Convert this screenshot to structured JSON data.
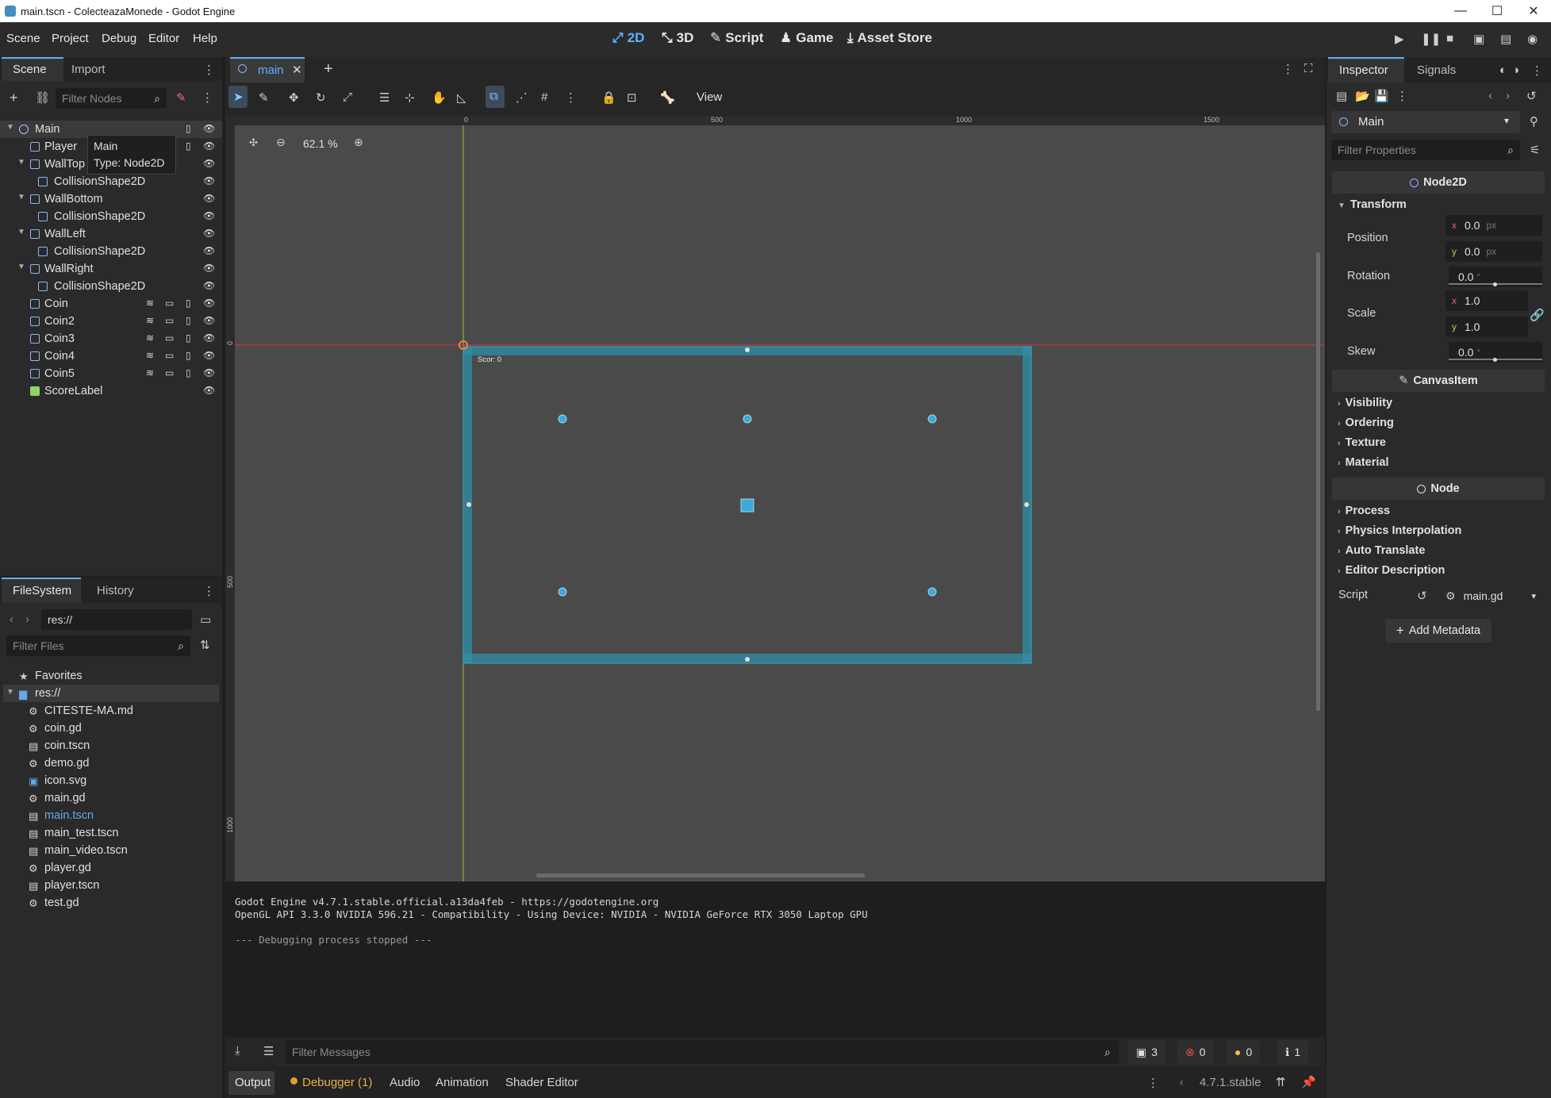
{
  "window": {
    "title": "main.tscn - ColecteazaMonede - Godot Engine"
  },
  "menu": [
    "Scene",
    "Project",
    "Debug",
    "Editor",
    "Help"
  ],
  "modes": {
    "m2d": "2D",
    "m3d": "3D",
    "script": "Script",
    "game": "Game",
    "asset": "Asset Store"
  },
  "scene_dock": {
    "tabs": [
      "Scene",
      "Import"
    ],
    "filter_placeholder": "Filter Nodes",
    "nodes": [
      {
        "name": "Main"
      },
      {
        "name": "Player"
      },
      {
        "name": "WallTop"
      },
      {
        "name": "CollisionShape2D"
      },
      {
        "name": "WallBottom"
      },
      {
        "name": "CollisionShape2D"
      },
      {
        "name": "WallLeft"
      },
      {
        "name": "CollisionShape2D"
      },
      {
        "name": "WallRight"
      },
      {
        "name": "CollisionShape2D"
      },
      {
        "name": "Coin"
      },
      {
        "name": "Coin2"
      },
      {
        "name": "Coin3"
      },
      {
        "name": "Coin4"
      },
      {
        "name": "Coin5"
      },
      {
        "name": "ScoreLabel"
      }
    ],
    "tooltip": {
      "name": "Main",
      "type": "Type: Node2D"
    }
  },
  "filesystem_dock": {
    "tabs": [
      "FileSystem",
      "History"
    ],
    "path": "res://",
    "filter_placeholder": "Filter Files",
    "favorites": "Favorites",
    "root": "res://",
    "files": [
      {
        "name": "CITESTE-MA.md",
        "icon": "gear"
      },
      {
        "name": "coin.gd",
        "icon": "gear"
      },
      {
        "name": "coin.tscn",
        "icon": "scene"
      },
      {
        "name": "demo.gd",
        "icon": "gear"
      },
      {
        "name": "icon.svg",
        "icon": "image"
      },
      {
        "name": "main.gd",
        "icon": "gear"
      },
      {
        "name": "main.tscn",
        "icon": "scene"
      },
      {
        "name": "main_test.tscn",
        "icon": "scene"
      },
      {
        "name": "main_video.tscn",
        "icon": "scene"
      },
      {
        "name": "player.gd",
        "icon": "gear"
      },
      {
        "name": "player.tscn",
        "icon": "scene"
      },
      {
        "name": "test.gd",
        "icon": "gear"
      }
    ]
  },
  "editor": {
    "tab": "main",
    "zoom": "62.1 %",
    "view_menu": "View",
    "ruler_h": [
      "0",
      "500",
      "1000",
      "1500"
    ],
    "ruler_v": [
      "0",
      "500",
      "1000"
    ],
    "score_text": "Scor: 0"
  },
  "output": {
    "lines": [
      "Godot Engine v4.7.1.stable.official.a13da4feb - https://godotengine.org",
      "OpenGL API 3.3.0 NVIDIA 596.21 - Compatibility - Using Device: NVIDIA - NVIDIA GeForce RTX 3050 Laptop GPU",
      "",
      "--- Debugging process stopped ---"
    ],
    "filter_placeholder": "Filter Messages",
    "counts": {
      "all": "3",
      "errors": "0",
      "warnings": "0",
      "info": "1"
    }
  },
  "bottom_tabs": [
    "Output",
    "Debugger (1)",
    "Audio",
    "Animation",
    "Shader Editor"
  ],
  "version": "4.7.1.stable",
  "inspector": {
    "tabs": [
      "Inspector",
      "Signals"
    ],
    "node": "Main",
    "filter_placeholder": "Filter Properties",
    "class": "Node2D",
    "transform": "Transform",
    "position_label": "Position",
    "position_x": "0.0",
    "position_y": "0.0",
    "unit_px": "px",
    "rotation_label": "Rotation",
    "rotation": "0.0",
    "scale_label": "Scale",
    "scale_x": "1.0",
    "scale_y": "1.0",
    "skew_label": "Skew",
    "skew": "0.0",
    "canvas_item": "CanvasItem",
    "canvas_cats": [
      "Visibility",
      "Ordering",
      "Texture",
      "Material"
    ],
    "node_section": "Node",
    "node_cats": [
      "Process",
      "Physics Interpolation",
      "Auto Translate",
      "Editor Description"
    ],
    "script_label": "Script",
    "script_value": "main.gd",
    "add_metadata": "Add Metadata"
  }
}
